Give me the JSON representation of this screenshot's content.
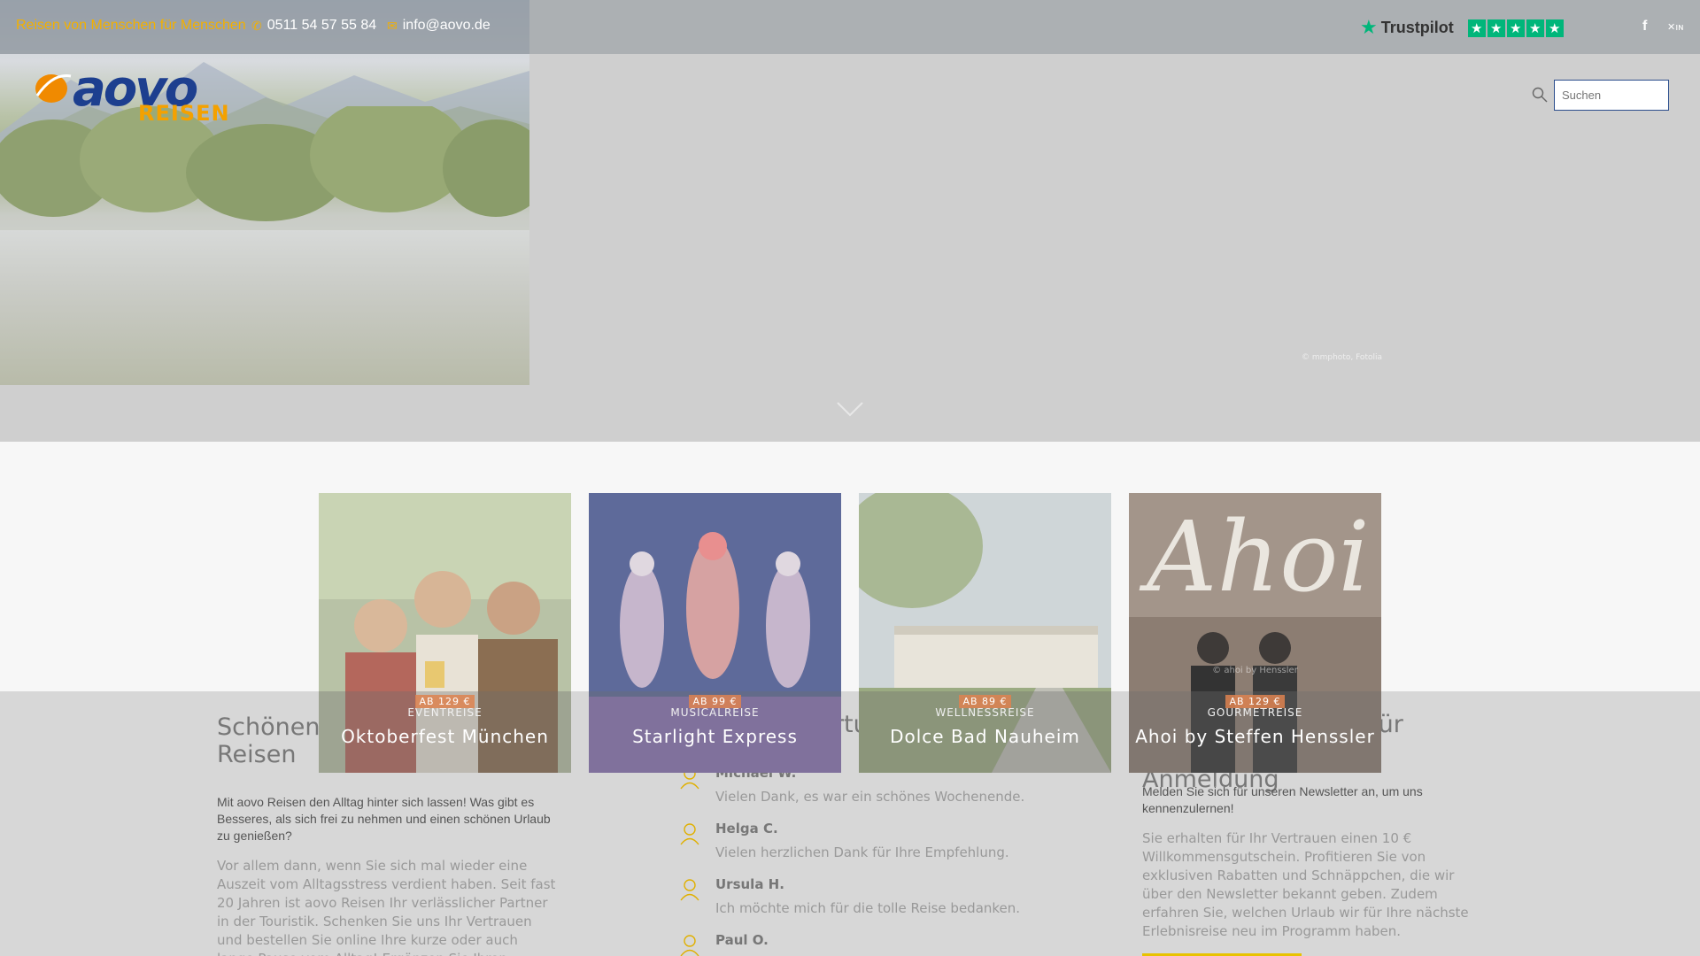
{
  "topbar": {
    "tagline": "Reisen von Menschen für Menschen",
    "phone": "0511 54 57 55 84",
    "email": "info@aovo.de",
    "trustpilot_label": "Trustpilot",
    "trustpilot_stars": 5,
    "social": [
      "facebook-icon",
      "xing-icon"
    ]
  },
  "logo": {
    "brand": "aovo",
    "sub": "REISEN"
  },
  "search": {
    "placeholder": "Suchen"
  },
  "hero": {
    "copyright": "© mmphoto, Fotolia"
  },
  "cards": [
    {
      "price": "AB 129 €",
      "category": "EVENTREISE",
      "title": "Oktoberfest München",
      "credit": ""
    },
    {
      "price": "AB 99 €",
      "category": "MUSICALREISE",
      "title": "Starlight Express",
      "credit": ""
    },
    {
      "price": "AB 89 €",
      "category": "WELLNESSREISE",
      "title": "Dolce Bad Nauheim",
      "credit": ""
    },
    {
      "price": "AB 129 €",
      "category": "GOURMETREISE",
      "title": "Ahoi by Steffen Henssler",
      "credit": "© ahoi by Henssler"
    }
  ],
  "about": {
    "title": "Schönen Urlaub! aovo Reisen",
    "intro": "Mit aovo Reisen den Alltag hinter sich lassen! Was gibt es Besseres, als sich frei zu nehmen und einen schönen Urlaub zu genießen?",
    "body": "Vor allem dann, wenn Sie sich mal wieder eine Auszeit vom Alltagsstress verdient haben. Seit fast 20 Jahren ist aovo Reisen Ihr verlässlicher Partner in der Touristik. Schenken Sie uns Ihr Vertrauen und bestellen Sie online Ihre kurze oder auch lange Pause vom Alltag! Ergänzen Sie Ihren Erlebnisurlaub"
  },
  "reviews": {
    "title": "Kundenbewertungen",
    "items": [
      {
        "name": "Michael W.",
        "quote": "Vielen Dank, es war ein schönes Wochenende."
      },
      {
        "name": "Helga C.",
        "quote": "Vielen herzlichen Dank für Ihre Empfehlung."
      },
      {
        "name": "Ursula H.",
        "quote": "Ich möchte mich für die tolle Reise bedanken."
      },
      {
        "name": "Paul O.",
        "quote": ""
      }
    ]
  },
  "newsletter": {
    "title": "10 Euro Gutschein für Newsletter-Anmeldung",
    "intro": "Melden Sie sich für unseren Newsletter an, um uns kennenzulernen!",
    "body": "Sie erhalten für Ihr Vertrauen einen 10 € Willkommensgutschein. Profitieren Sie von exklusiven Rabatten und Schnäppchen, die wir über den Newsletter bekannt geben. Zudem erfahren Sie, welchen Urlaub wir für Ihre nächste Erlebnisreise neu im Programm haben."
  },
  "colors": {
    "accent": "#f3b000",
    "brand": "#1d3f8f",
    "trustpilot": "#00b67a",
    "price_badge": "#de8250"
  }
}
